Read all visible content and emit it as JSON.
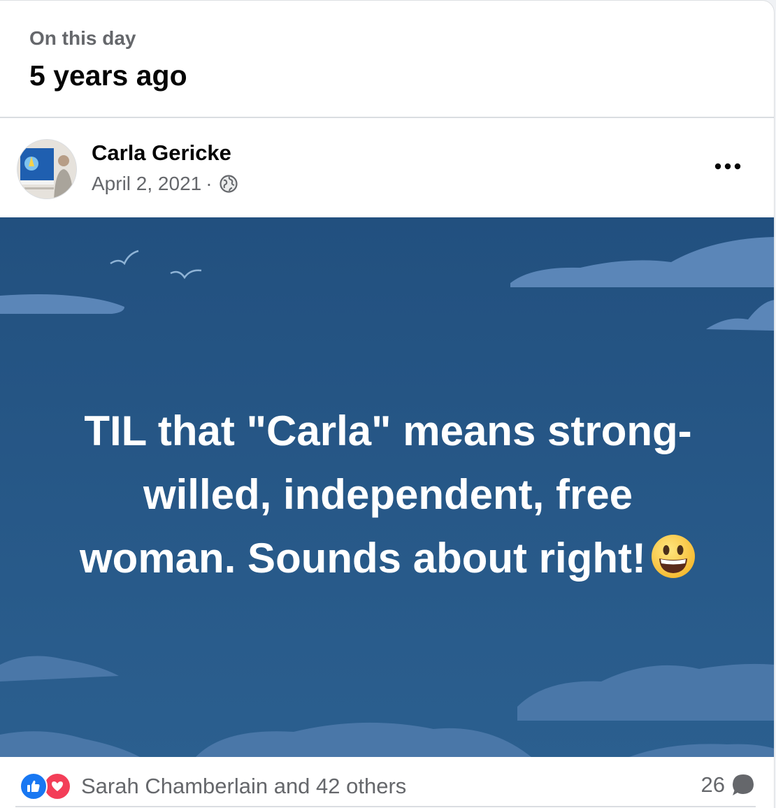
{
  "on_this_day": {
    "kicker": "On this day",
    "title": "5 years ago"
  },
  "post": {
    "author": "Carla Gericke",
    "date": "April 2, 2021",
    "separator": "·",
    "audience_icon": "globe-icon",
    "more_icon": "more-options-icon",
    "background_color": "#245584",
    "text_line_1": "TIL that \"Carla\" means strong-",
    "text_line_2": "willed, independent, free",
    "text_line_3": "woman. Sounds about right!",
    "emoji": "grinning-face-emoji"
  },
  "footer": {
    "reaction_icons": [
      "like-icon",
      "love-icon"
    ],
    "reactions_text": "Sarah Chamberlain and 42 others",
    "comment_count": "26",
    "comment_icon": "comment-icon"
  },
  "colors": {
    "like": "#1877f2",
    "love": "#f33e58",
    "secondary_text": "#65676b",
    "primary_text": "#050505"
  }
}
